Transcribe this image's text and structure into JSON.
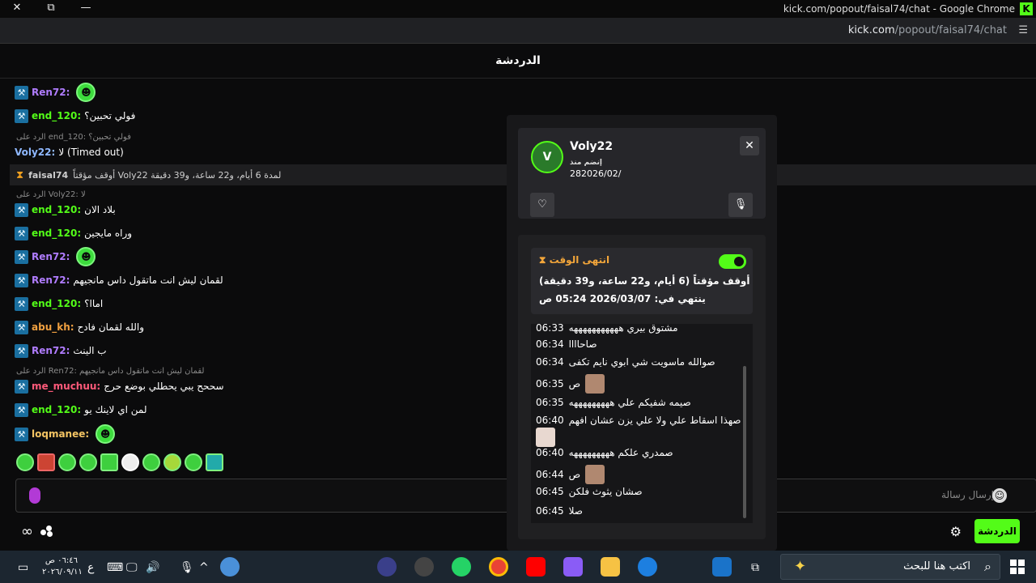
{
  "window": {
    "title": "kick.com/popout/faisal74/chat - Google Chrome",
    "close_glyph": "✕",
    "restore_glyph": "⧉",
    "minimize_glyph": "—",
    "k_logo": "K"
  },
  "address_bar": {
    "domain": "kick.com",
    "path": "/popout/faisal74/chat"
  },
  "chat": {
    "header_title": "الدردشة",
    "input_placeholder": "إرسال رسالة",
    "send_label": "الدردشة",
    "messages": [
      {
        "user": "Ren72:",
        "text": "",
        "user_color": "#b07cff"
      },
      {
        "user": "end_120:",
        "text": "فولي تحبين؟",
        "user_color": "#53fc18"
      },
      {
        "user": "Voly22:",
        "text": "لا (Timed out)",
        "user_color": "#8fb8ff"
      },
      {
        "user": "end_120:",
        "text": "بلاد الان",
        "user_color": "#53fc18"
      },
      {
        "user": "end_120:",
        "text": "وراه مايجين",
        "user_color": "#53fc18"
      },
      {
        "user": "Ren72:",
        "text": "",
        "user_color": "#b07cff"
      },
      {
        "user": "Ren72:",
        "text": "لقمان ليش انت ماتقول داس مانجيهم",
        "user_color": "#b07cff"
      },
      {
        "user": "end_120:",
        "text": "اماا؟",
        "user_color": "#53fc18"
      },
      {
        "user": "abu_kh:",
        "text": "والله لقمان فادح",
        "user_color": "#f0a040"
      },
      {
        "user": "Ren72:",
        "text": "ب الينث",
        "user_color": "#b07cff"
      },
      {
        "user": "me_muchuu:",
        "text": "سححح يبي يحطلي بوضع حرج",
        "user_color": "#ff5a7a"
      },
      {
        "user": "end_120:",
        "text": "لمن اي لاينك يو",
        "user_color": "#53fc18"
      },
      {
        "user": "loqmanee:",
        "text": "",
        "user_color": "#f4c463"
      }
    ],
    "replies": [
      "الرد على end_120: فولي تحبين؟",
      "الرد على Voly22: لا",
      "الرد على Ren72: لقمان ليش انت ماتقول داس مانجيهم"
    ],
    "mod_line": {
      "mod": "faisal74",
      "text": "أوقف مؤقتاً Voly22 لمدة 6 أيام، و22 ساعة، و39 دقيقة"
    },
    "badge_glyph": "⚒",
    "emote_glyph": "☻"
  },
  "user_card": {
    "username": "Voly22",
    "avatar_initial": "V",
    "since_label": "إنضم منذ",
    "joined_date": "282026/02/",
    "close_glyph": "✕",
    "heart_glyph": "♡",
    "mute_glyph": "🎙"
  },
  "timeout": {
    "header": "انتهى الوقت",
    "hourglass_glyph": "⧗",
    "enabled": true,
    "line1": "أوقف مؤقتاً (6 أيام، و22 ساعة، و39 دقيقة)",
    "line2": "ينتهي في: 2026/03/07 05:24 ص"
  },
  "log": [
    {
      "time": "06:33",
      "text": "مشتوق بيري هههههههههههه",
      "face": false
    },
    {
      "time": "06:34",
      "text": "صاحاااا",
      "face": false
    },
    {
      "time": "06:34",
      "text": "صوالله ماسويت شي ابوي نايم تكفى",
      "face": false
    },
    {
      "time": "06:35",
      "text": "ص",
      "face": true
    },
    {
      "time": "06:35",
      "text": "صيمه شفيكم علي هههههههههه",
      "face": false
    },
    {
      "time": "06:40",
      "text": "صهذا اسقاط علي ولا علي يزن عشان افهم",
      "face": true
    },
    {
      "time": "06:40",
      "text": "صمدري علكم هههههههههه",
      "face": false
    },
    {
      "time": "06:44",
      "text": "ص",
      "face": true
    },
    {
      "time": "06:45",
      "text": "صشان يثوث فلكن",
      "face": false
    },
    {
      "time": "06:45",
      "text": "صلا",
      "face": false
    }
  ],
  "bottom": {
    "infinity_glyph": "∞",
    "gear_glyph": "⚙"
  },
  "taskbar": {
    "search_label": "اكتب هنا للبحث",
    "search_glyph": "⌕",
    "spark_glyph": "✦",
    "clock_time": "٠٦:٤٦ ص",
    "clock_date": "٢٠٢٦/٠٩/١١",
    "lang": "ع",
    "tray": [
      "⌨",
      "🖵",
      "🔊",
      "🎙",
      "^"
    ],
    "apps": [
      "#3a3f8a",
      "#444",
      "#25d366",
      "#e0e0e0",
      "#ff0000",
      "#8a5cf6",
      "#f6c244",
      "#1d7fe0",
      "#1a73c9"
    ]
  }
}
